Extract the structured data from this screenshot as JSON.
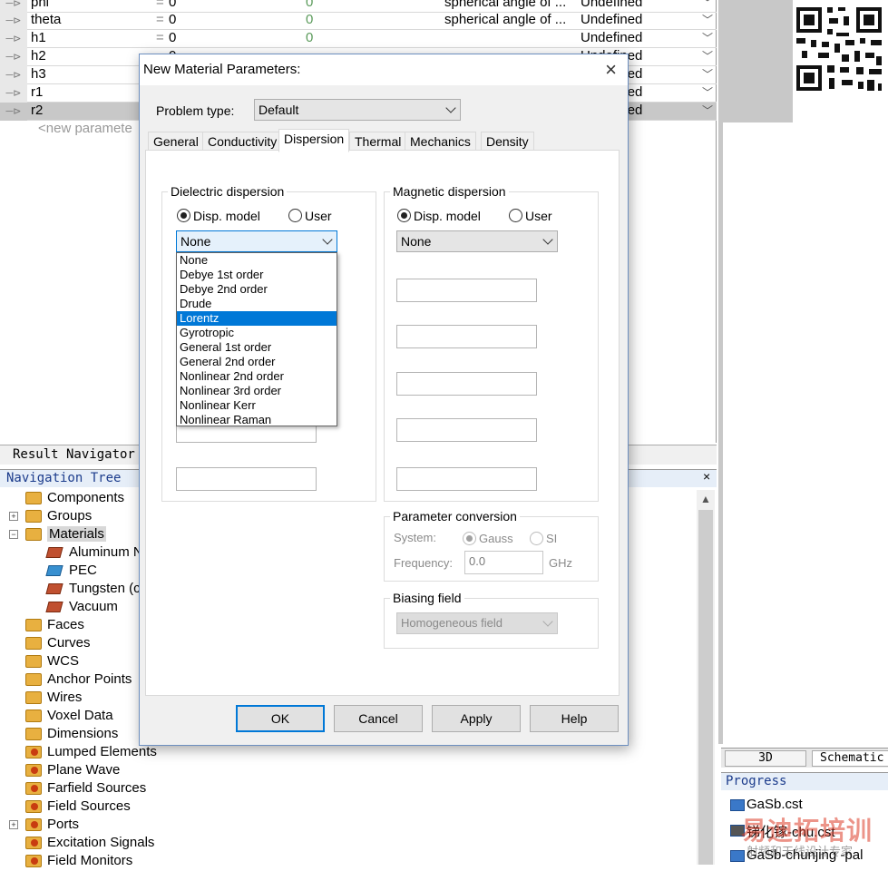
{
  "param_table": {
    "rows": [
      {
        "name": "phi",
        "eq": "=",
        "value": "0",
        "result": "0",
        "desc": "spherical angle of ...",
        "type": "Undefined"
      },
      {
        "name": "theta",
        "eq": "=",
        "value": "0",
        "result": "0",
        "desc": "spherical angle of ...",
        "type": "Undefined"
      },
      {
        "name": "h1",
        "eq": "=",
        "value": "0",
        "result": "0",
        "desc": "",
        "type": "Undefined"
      },
      {
        "name": "h2",
        "eq": "",
        "value": "0",
        "result": "",
        "desc": "",
        "type": "Undefined"
      },
      {
        "name": "h3",
        "eq": "",
        "value": "",
        "result": "",
        "desc": "",
        "type": "Undefined"
      },
      {
        "name": "r1",
        "eq": "",
        "value": "",
        "result": "",
        "desc": "",
        "type": "Undefined"
      },
      {
        "name": "r2",
        "eq": "",
        "value": "",
        "result": "",
        "desc": "",
        "type": "Undefined"
      }
    ],
    "new_param_placeholder": "<new paramete"
  },
  "result_navigator": {
    "label": "Result Navigator"
  },
  "navigation_tree": {
    "title": "Navigation Tree",
    "close": "×",
    "items": [
      {
        "label": "Components"
      },
      {
        "label": "Groups"
      },
      {
        "label": "Materials"
      },
      {
        "label": "Aluminum N"
      },
      {
        "label": "PEC"
      },
      {
        "label": "Tungsten (c"
      },
      {
        "label": "Vacuum"
      },
      {
        "label": "Faces"
      },
      {
        "label": "Curves"
      },
      {
        "label": "WCS"
      },
      {
        "label": "Anchor Points"
      },
      {
        "label": "Wires"
      },
      {
        "label": "Voxel Data"
      },
      {
        "label": "Dimensions"
      },
      {
        "label": "Lumped Elements"
      },
      {
        "label": "Plane Wave"
      },
      {
        "label": "Farfield Sources"
      },
      {
        "label": "Field Sources"
      },
      {
        "label": "Ports"
      },
      {
        "label": "Excitation Signals"
      },
      {
        "label": "Field Monitors"
      }
    ]
  },
  "view_tabs": {
    "tab_3d": "3D",
    "tab_schematic": "Schematic"
  },
  "progress": {
    "title": "Progress",
    "items": [
      "GaSb.cst",
      "锑化镓-chu.cst",
      "GaSb-chunjing -pal"
    ]
  },
  "watermark": {
    "text": "易迪拓培训",
    "sub": "射频和天线设计专家"
  },
  "dialog": {
    "title": "New Material Parameters:",
    "close": "×",
    "problem_type_label": "Problem type:",
    "problem_type_value": "Default",
    "tabs": [
      "General",
      "Conductivity",
      "Dispersion",
      "Thermal",
      "Mechanics",
      "Density"
    ],
    "active_tab": "Dispersion",
    "dielectric": {
      "title": "Dielectric dispersion",
      "radio_model": "Disp. model",
      "radio_user": "User",
      "selected": "None",
      "options": [
        "None",
        "Debye 1st order",
        "Debye 2nd order",
        "Drude",
        "Lorentz",
        "Gyrotropic",
        "General 1st order",
        "General 2nd order",
        "Nonlinear 2nd order",
        "Nonlinear 3rd order",
        "Nonlinear Kerr",
        "Nonlinear Raman"
      ],
      "highlighted": "Lorentz"
    },
    "magnetic": {
      "title": "Magnetic dispersion",
      "radio_model": "Disp. model",
      "radio_user": "User",
      "selected": "None"
    },
    "param_conversion": {
      "title": "Parameter conversion",
      "system_label": "System:",
      "gauss": "Gauss",
      "si": "SI",
      "frequency_label": "Frequency:",
      "frequency_value": "0.0",
      "frequency_unit": "GHz"
    },
    "biasing": {
      "title": "Biasing field",
      "value": "Homogeneous field"
    },
    "buttons": {
      "ok": "OK",
      "cancel": "Cancel",
      "apply": "Apply",
      "help": "Help"
    }
  }
}
